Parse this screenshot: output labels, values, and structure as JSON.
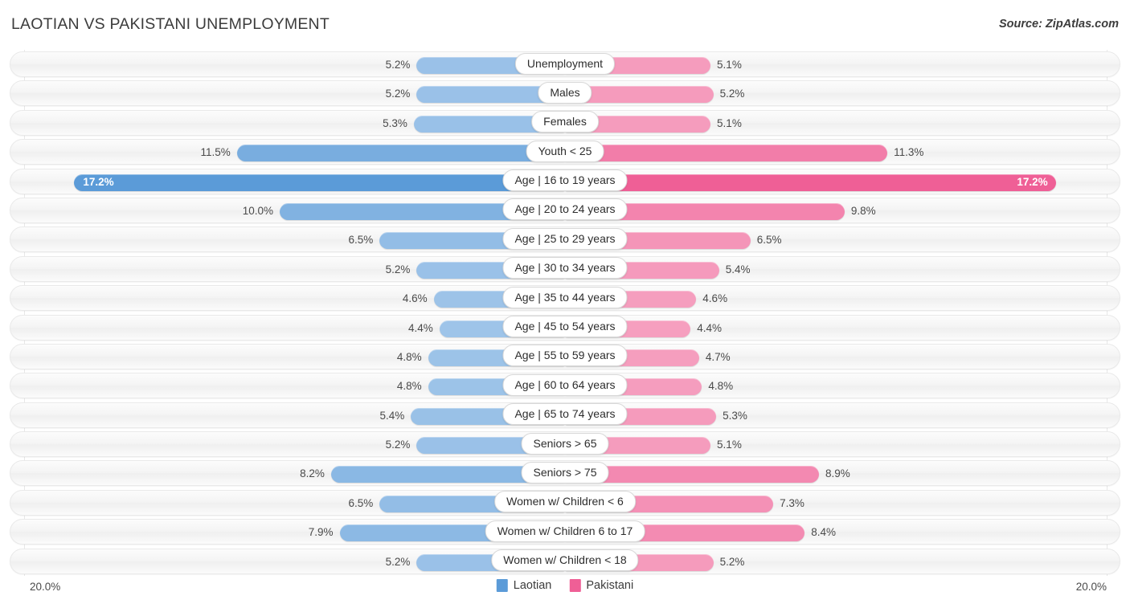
{
  "header": {
    "title": "LAOTIAN VS PAKISTANI UNEMPLOYMENT",
    "source": "Source: ZipAtlas.com"
  },
  "footer": {
    "axis_left": "20.0%",
    "axis_right": "20.0%",
    "legend": [
      {
        "label": "Laotian",
        "color": "#5b9bd8"
      },
      {
        "label": "Pakistani",
        "color": "#ef5f96"
      }
    ]
  },
  "colors": {
    "left_base": "#5b9bd8",
    "left_light": "#a3c7ea",
    "right_base": "#ef5f96",
    "right_light": "#f6a4c2",
    "track": "#f4f4f4",
    "gridline": "#e8e8e8",
    "text": "#4a4a4a"
  },
  "chart_data": {
    "type": "bar",
    "subtype": "diverging-bidirectional",
    "title": "LAOTIAN VS PAKISTANI UNEMPLOYMENT",
    "xlabel": "",
    "ylabel": "",
    "xlim": [
      20.0,
      20.0
    ],
    "axis_max": 20.0,
    "unit": "%",
    "grid": true,
    "legend_position": "bottom-center",
    "categories": [
      "Unemployment",
      "Males",
      "Females",
      "Youth < 25",
      "Age | 16 to 19 years",
      "Age | 20 to 24 years",
      "Age | 25 to 29 years",
      "Age | 30 to 34 years",
      "Age | 35 to 44 years",
      "Age | 45 to 54 years",
      "Age | 55 to 59 years",
      "Age | 60 to 64 years",
      "Age | 65 to 74 years",
      "Seniors > 65",
      "Seniors > 75",
      "Women w/ Children < 6",
      "Women w/ Children 6 to 17",
      "Women w/ Children < 18"
    ],
    "series": [
      {
        "name": "Laotian",
        "side": "left",
        "color": "#5b9bd8",
        "values": [
          5.2,
          5.2,
          5.3,
          11.5,
          17.2,
          10.0,
          6.5,
          5.2,
          4.6,
          4.4,
          4.8,
          4.8,
          5.4,
          5.2,
          8.2,
          6.5,
          7.9,
          5.2
        ],
        "labels": [
          "5.2%",
          "5.2%",
          "5.3%",
          "11.5%",
          "17.2%",
          "10.0%",
          "6.5%",
          "5.2%",
          "4.6%",
          "4.4%",
          "4.8%",
          "4.8%",
          "5.4%",
          "5.2%",
          "8.2%",
          "6.5%",
          "7.9%",
          "5.2%"
        ]
      },
      {
        "name": "Pakistani",
        "side": "right",
        "color": "#ef5f96",
        "values": [
          5.1,
          5.2,
          5.1,
          11.3,
          17.2,
          9.8,
          6.5,
          5.4,
          4.6,
          4.4,
          4.7,
          4.8,
          5.3,
          5.1,
          8.9,
          7.3,
          8.4,
          5.2
        ],
        "labels": [
          "5.1%",
          "5.2%",
          "5.1%",
          "11.3%",
          "17.2%",
          "9.8%",
          "6.5%",
          "5.4%",
          "4.6%",
          "4.4%",
          "4.7%",
          "4.8%",
          "5.3%",
          "5.1%",
          "8.9%",
          "7.3%",
          "8.4%",
          "5.2%"
        ]
      }
    ]
  }
}
